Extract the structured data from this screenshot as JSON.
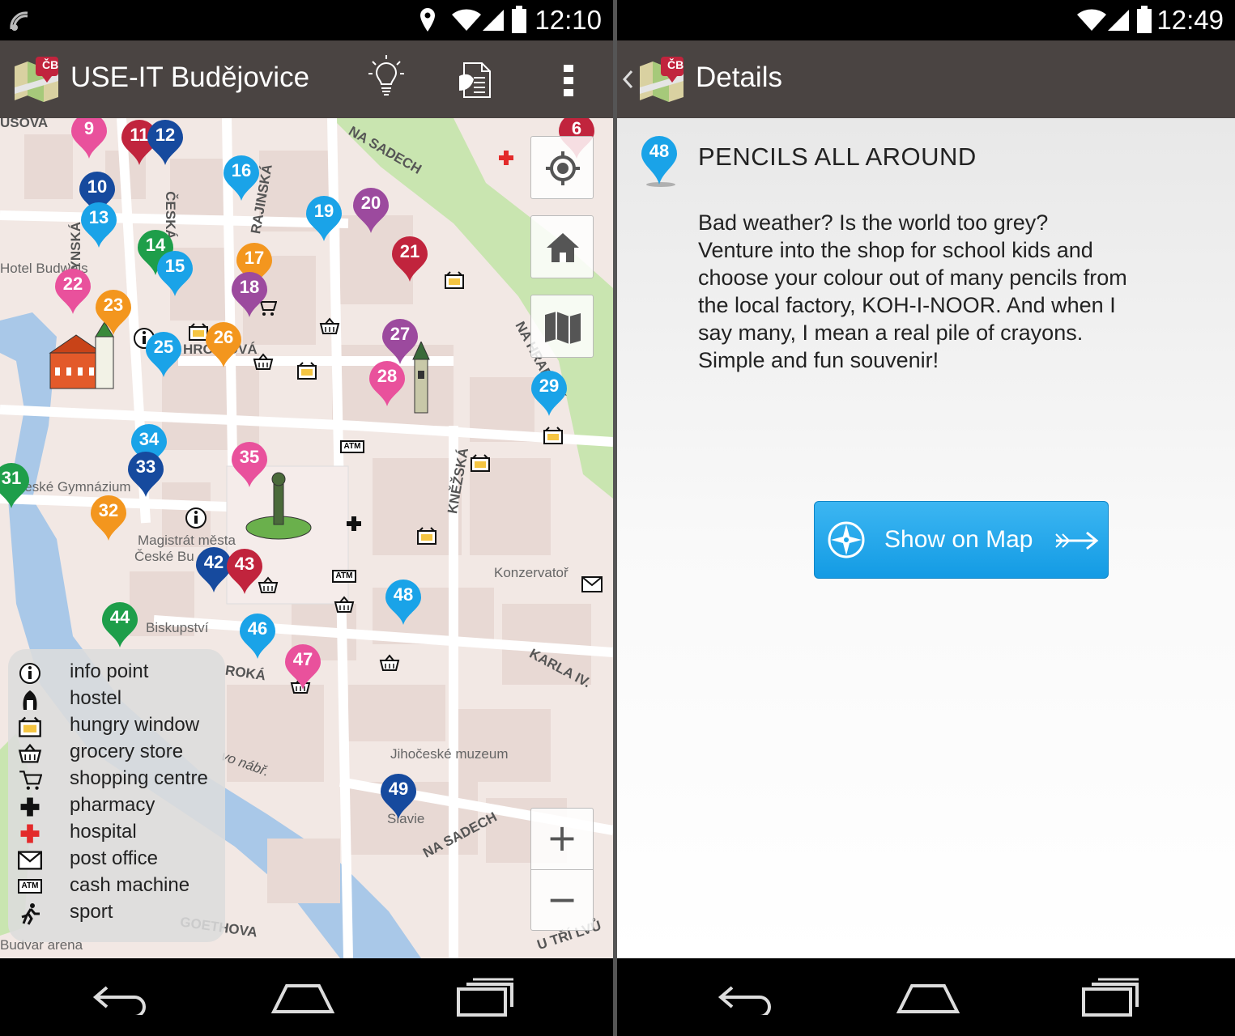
{
  "left": {
    "status": {
      "time": "12:10"
    },
    "appbar": {
      "title": "USE-IT Budějovice",
      "logo_text": "ČB"
    },
    "map": {
      "roads": {
        "na_sadech_top": "NA SADECH",
        "na_sadech_bottom": "NA SADECH",
        "karla_iv": "KARLA IV.",
        "knezska": "KNĚŽSKÁ",
        "ceska": "ČESKÁ",
        "krajinska": "RAJINSKÁ",
        "mlynska": "MLÝNSKÁ",
        "siroka": "ROKÁ",
        "u_trivu": "U TŘÍ LVŮ",
        "gothova": "GOETHOVA",
        "hradebni": "NA HRADBNÍ",
        "ostrov": "vo nábř.",
        "hroznova": "HRO   NOVÁ",
        "jirovcova": "USOVA"
      },
      "places": {
        "hotel": "Hotel Budweis",
        "gymnazium": "České Gymnázium",
        "magistrat": "Magistrát města",
        "magistrat2": "České Bu",
        "biskupstvi": "Biskupství",
        "konzervator": "Konzervatoř",
        "muzeum": "Jihočeské muzeum",
        "slavie": "Slavie",
        "budvar": "Budvar arena"
      },
      "pins": [
        {
          "n": "9",
          "color": "#e9519c"
        },
        {
          "n": "11",
          "color": "#c1243d"
        },
        {
          "n": "12",
          "color": "#164a9e"
        },
        {
          "n": "6",
          "color": "#c1243d"
        },
        {
          "n": "10",
          "color": "#164a9e"
        },
        {
          "n": "16",
          "color": "#1aa3e8"
        },
        {
          "n": "13",
          "color": "#1aa3e8"
        },
        {
          "n": "19",
          "color": "#1aa3e8"
        },
        {
          "n": "20",
          "color": "#9c4a9e"
        },
        {
          "n": "14",
          "color": "#1e9e4a"
        },
        {
          "n": "17",
          "color": "#f3961e"
        },
        {
          "n": "21",
          "color": "#c1243d"
        },
        {
          "n": "15",
          "color": "#1aa3e8"
        },
        {
          "n": "22",
          "color": "#e9519c"
        },
        {
          "n": "18",
          "color": "#9c4a9e"
        },
        {
          "n": "23",
          "color": "#f3961e"
        },
        {
          "n": "27",
          "color": "#9c4a9e"
        },
        {
          "n": "25",
          "color": "#1aa3e8"
        },
        {
          "n": "26",
          "color": "#f3961e"
        },
        {
          "n": "28",
          "color": "#e9519c"
        },
        {
          "n": "29",
          "color": "#1aa3e8"
        },
        {
          "n": "34",
          "color": "#1aa3e8"
        },
        {
          "n": "33",
          "color": "#164a9e"
        },
        {
          "n": "35",
          "color": "#e9519c"
        },
        {
          "n": "31",
          "color": "#1e9e4a"
        },
        {
          "n": "32",
          "color": "#f3961e"
        },
        {
          "n": "42",
          "color": "#164a9e"
        },
        {
          "n": "43",
          "color": "#c1243d"
        },
        {
          "n": "48",
          "color": "#1aa3e8"
        },
        {
          "n": "44",
          "color": "#1e9e4a"
        },
        {
          "n": "46",
          "color": "#1aa3e8"
        },
        {
          "n": "47",
          "color": "#e9519c"
        },
        {
          "n": "49",
          "color": "#164a9e"
        }
      ],
      "controls": {
        "zoom_in": "+",
        "zoom_out": "−"
      }
    },
    "legend": [
      {
        "icon": "info-icon",
        "label": "info point"
      },
      {
        "icon": "hostel-icon",
        "label": "hostel"
      },
      {
        "icon": "hungry-window-icon",
        "label": "hungry window"
      },
      {
        "icon": "grocery-basket-icon",
        "label": "grocery store"
      },
      {
        "icon": "shopping-cart-icon",
        "label": "shopping centre"
      },
      {
        "icon": "pharmacy-cross-icon",
        "label": "pharmacy"
      },
      {
        "icon": "hospital-cross-icon",
        "label": "hospital"
      },
      {
        "icon": "envelope-icon",
        "label": "post office"
      },
      {
        "icon": "atm-icon",
        "label": "cash machine"
      },
      {
        "icon": "runner-icon",
        "label": "sport"
      }
    ],
    "atm_text": "ATM"
  },
  "right": {
    "status": {
      "time": "12:49"
    },
    "appbar": {
      "title": "Details",
      "logo_text": "ČB"
    },
    "detail": {
      "pin_number": "48",
      "pin_color": "#1aa3e8",
      "title": "PENCILS ALL AROUND",
      "body": "Bad weather? Is the world too grey? Venture into the shop for school kids and choose your colour out of many pencils from the local factory, KOH-I-NOOR. And when I say many, I mean a real pile of crayons. Simple and fun souvenir!",
      "button_label": "Show on Map"
    }
  },
  "colors": {
    "actionbar": "#4a4442",
    "accent_blue": "#1aa3e8",
    "map_background": "#f2e8e4",
    "river": "#a9c8e8",
    "park": "#c9e5b0"
  }
}
